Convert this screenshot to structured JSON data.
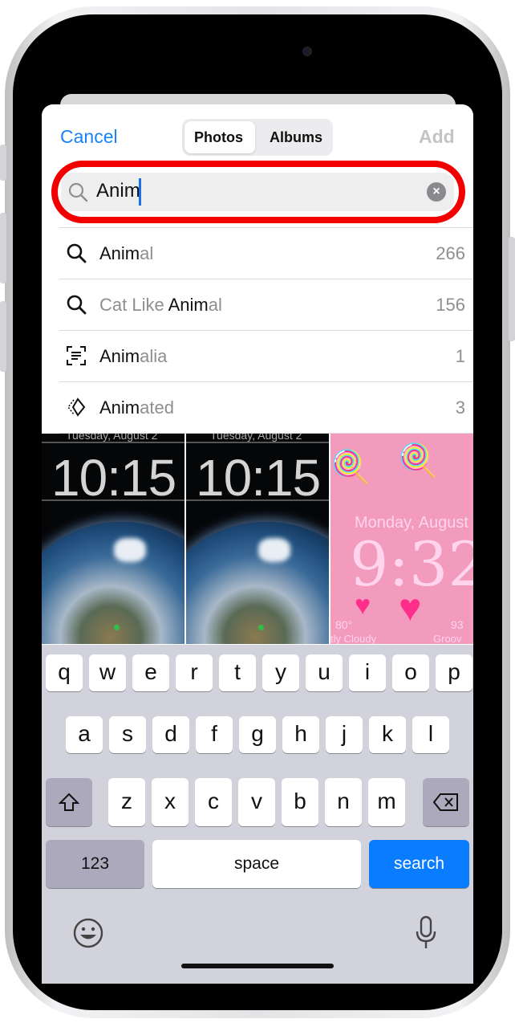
{
  "nav": {
    "cancel": "Cancel",
    "add": "Add",
    "tabs": [
      {
        "label": "Photos",
        "selected": true
      },
      {
        "label": "Albums",
        "selected": false
      }
    ]
  },
  "search": {
    "value": "Anim",
    "clear_icon": "clear-icon"
  },
  "colors": {
    "accent": "#1a82f7",
    "highlight_ring": "#f20000",
    "search_key": "#0a7cff"
  },
  "suggestions": [
    {
      "icon": "search-icon",
      "pre": "",
      "match": "Anim",
      "rest": "al",
      "count": "266"
    },
    {
      "icon": "search-icon",
      "pre": "Cat Like ",
      "match": "Anim",
      "rest": "al",
      "count": "156"
    },
    {
      "icon": "text-scan-icon",
      "pre": "",
      "match": "Anim",
      "rest": "alia",
      "count": "1"
    },
    {
      "icon": "animated-icon",
      "pre": "",
      "match": "Anim",
      "rest": "ated",
      "count": "3"
    }
  ],
  "thumbnails": [
    {
      "date": "Tuesday, August 2",
      "time": "10:15"
    },
    {
      "date": "Tuesday, August 2",
      "time": "10:15"
    },
    {
      "date": "Monday, August",
      "time": "9:32",
      "temp": "80°",
      "battery": "93",
      "weather": "tly Cloudy",
      "extra": "Groov"
    }
  ],
  "keyboard": {
    "row1": [
      "q",
      "w",
      "e",
      "r",
      "t",
      "y",
      "u",
      "i",
      "o",
      "p"
    ],
    "row2": [
      "a",
      "s",
      "d",
      "f",
      "g",
      "h",
      "j",
      "k",
      "l"
    ],
    "row3": [
      "z",
      "x",
      "c",
      "v",
      "b",
      "n",
      "m"
    ],
    "numbers": "123",
    "space": "space",
    "search": "search"
  }
}
